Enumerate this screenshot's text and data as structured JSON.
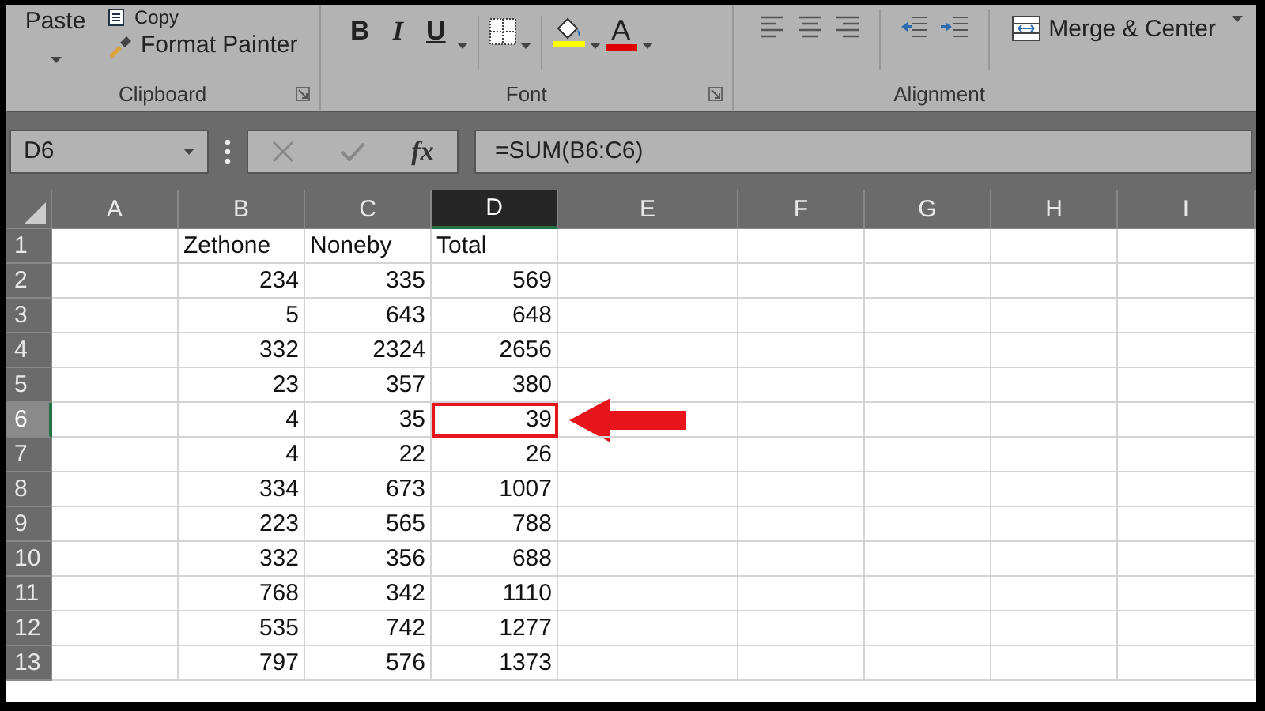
{
  "ribbon": {
    "clipboard": {
      "label": "Clipboard",
      "paste": "Paste",
      "copy": "Copy",
      "format_painter": "Format Painter"
    },
    "font": {
      "label": "Font",
      "bold": "B",
      "italic": "I",
      "underline": "U",
      "font_color": "A"
    },
    "alignment": {
      "label": "Alignment",
      "merge": "Merge & Center"
    }
  },
  "formula_bar": {
    "name_box": "D6",
    "function_button": "fx",
    "formula": "=SUM(B6:C6)"
  },
  "sheet": {
    "columns": [
      {
        "label": "A",
        "selected": false
      },
      {
        "label": "B",
        "selected": false
      },
      {
        "label": "C",
        "selected": false
      },
      {
        "label": "D",
        "selected": true
      },
      {
        "label": "E",
        "selected": false
      },
      {
        "label": "F",
        "selected": false
      },
      {
        "label": "G",
        "selected": false
      },
      {
        "label": "H",
        "selected": false
      },
      {
        "label": "I",
        "selected": false
      }
    ],
    "rows": [
      {
        "header": "1",
        "selected": false,
        "cells": [
          {
            "text": "Zethone",
            "highlighted": false
          },
          {
            "text": "Noneby",
            "highlighted": false
          },
          {
            "text": "Total",
            "highlighted": false
          }
        ]
      },
      {
        "header": "2",
        "selected": false,
        "cells": [
          {
            "text": "234",
            "highlighted": false
          },
          {
            "text": "335",
            "highlighted": false
          },
          {
            "text": "569",
            "highlighted": false
          }
        ]
      },
      {
        "header": "3",
        "selected": false,
        "cells": [
          {
            "text": "5",
            "highlighted": false
          },
          {
            "text": "643",
            "highlighted": false
          },
          {
            "text": "648",
            "highlighted": false
          }
        ]
      },
      {
        "header": "4",
        "selected": false,
        "cells": [
          {
            "text": "332",
            "highlighted": false
          },
          {
            "text": "2324",
            "highlighted": false
          },
          {
            "text": "2656",
            "highlighted": false
          }
        ]
      },
      {
        "header": "5",
        "selected": false,
        "cells": [
          {
            "text": "23",
            "highlighted": false
          },
          {
            "text": "357",
            "highlighted": false
          },
          {
            "text": "380",
            "highlighted": false
          }
        ]
      },
      {
        "header": "6",
        "selected": true,
        "cells": [
          {
            "text": "4",
            "highlighted": false
          },
          {
            "text": "35",
            "highlighted": false
          },
          {
            "text": "39",
            "highlighted": true
          }
        ]
      },
      {
        "header": "7",
        "selected": false,
        "cells": [
          {
            "text": "4",
            "highlighted": false
          },
          {
            "text": "22",
            "highlighted": false
          },
          {
            "text": "26",
            "highlighted": false
          }
        ]
      },
      {
        "header": "8",
        "selected": false,
        "cells": [
          {
            "text": "334",
            "highlighted": false
          },
          {
            "text": "673",
            "highlighted": false
          },
          {
            "text": "1007",
            "highlighted": false
          }
        ]
      },
      {
        "header": "9",
        "selected": false,
        "cells": [
          {
            "text": "223",
            "highlighted": false
          },
          {
            "text": "565",
            "highlighted": false
          },
          {
            "text": "788",
            "highlighted": false
          }
        ]
      },
      {
        "header": "10",
        "selected": false,
        "cells": [
          {
            "text": "332",
            "highlighted": false
          },
          {
            "text": "356",
            "highlighted": false
          },
          {
            "text": "688",
            "highlighted": false
          }
        ]
      },
      {
        "header": "11",
        "selected": false,
        "cells": [
          {
            "text": "768",
            "highlighted": false
          },
          {
            "text": "342",
            "highlighted": false
          },
          {
            "text": "1110",
            "highlighted": false
          }
        ]
      },
      {
        "header": "12",
        "selected": false,
        "cells": [
          {
            "text": "535",
            "highlighted": false
          },
          {
            "text": "742",
            "highlighted": false
          },
          {
            "text": "1277",
            "highlighted": false
          }
        ]
      },
      {
        "header": "13",
        "selected": false,
        "cells": [
          {
            "text": "797",
            "highlighted": false
          },
          {
            "text": "576",
            "highlighted": false
          },
          {
            "text": "1373",
            "highlighted": false
          }
        ]
      }
    ]
  }
}
